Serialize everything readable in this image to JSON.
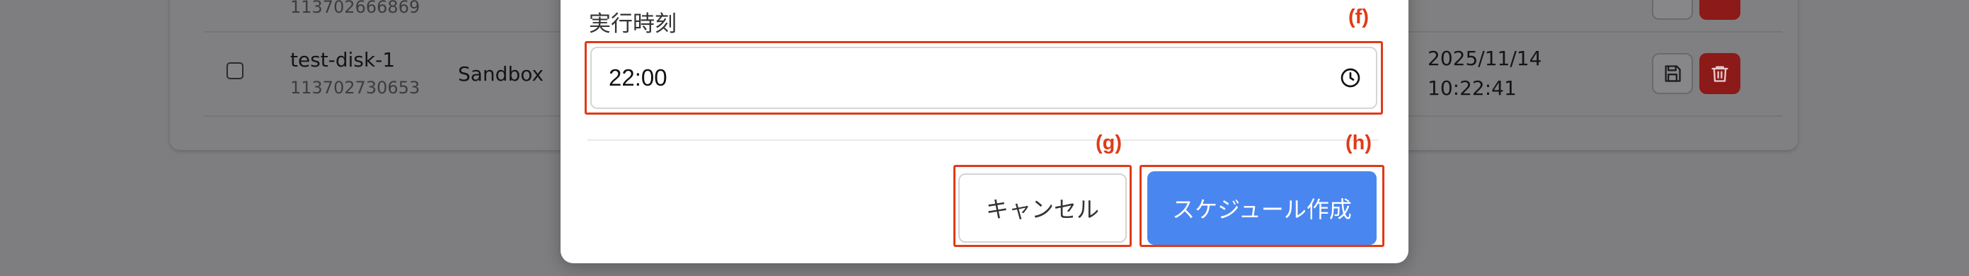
{
  "background_table": {
    "top_row": {
      "id": "113702666869"
    },
    "row": {
      "name": "test-disk-1",
      "id": "113702730653",
      "env": "Sandbox",
      "date": "2025/11/14",
      "time": "10:22:41"
    },
    "icons": {
      "save": "save-icon",
      "delete": "trash-icon"
    }
  },
  "modal": {
    "field_label": "実行時刻",
    "time_value": "22:00",
    "clock_icon": "clock-icon",
    "cancel_label": "キャンセル",
    "create_label": "スケジュール作成"
  },
  "annotations": {
    "f": "(f)",
    "g": "(g)",
    "h": "(h)",
    "color": "#e03a17"
  },
  "colors": {
    "primary_button": "#4a86f0",
    "delete_button": "#8c1a18"
  }
}
